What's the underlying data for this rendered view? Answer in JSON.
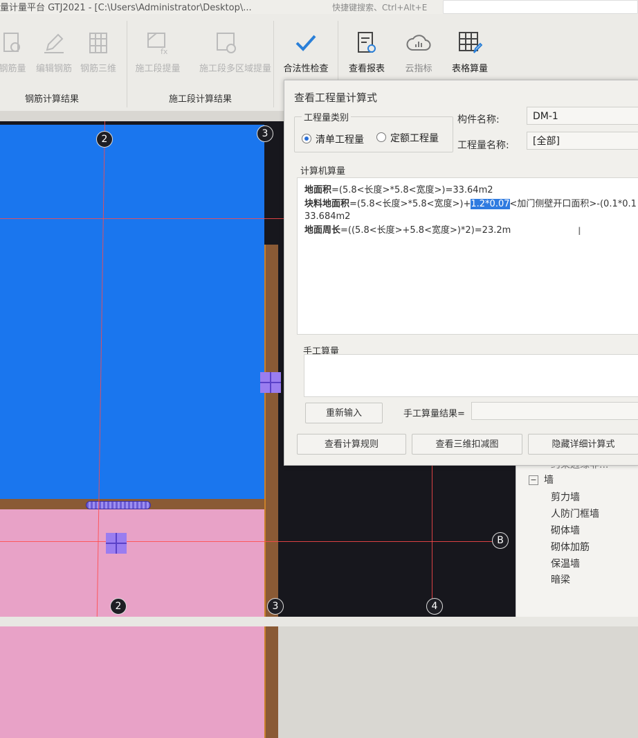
{
  "window": {
    "title": "量计量平台 GTJ2021 - [C:\\Users\\Administrator\\Desktop\\...",
    "shortcut_search": "快捷键搜索、Ctrl+Alt+E"
  },
  "ribbon": {
    "steel_buttons": [
      "钢筋量",
      "编辑钢筋",
      "钢筋三维"
    ],
    "steel_group": "钢筋计算结果",
    "construction_buttons": [
      "施工段提量",
      "施工段多区域提量"
    ],
    "construction_group": "施工段计算结果",
    "check_button": "合法性检查",
    "report_button": "查看报表",
    "cloud_button": "云指标",
    "table_button": "表格算量"
  },
  "dialog": {
    "title": "查看工程量计算式",
    "category_legend": "工程量类别",
    "radio_bill": "清单工程量",
    "radio_quota": "定额工程量",
    "component_label": "构件名称:",
    "component_value": "DM-1",
    "quantity_label": "工程量名称:",
    "quantity_value": "[全部]",
    "computer_legend": "计算机算量",
    "line1_label": "地面积",
    "line1_text": "=(5.8<长度>*5.8<宽度>)=33.64m2",
    "line2_label": "块料地面积",
    "line2_pre": "=(5.8<长度>*5.8<宽度>)+",
    "line2_highlight": "1.2*0.07",
    "line2_post": "<加门侧壁开口面积>-(0.1*0.1",
    "line3_text": "33.684m2",
    "line4_label": "地面周长",
    "line4_text": "=((5.8<长度>+5.8<宽度>)*2)=23.2m",
    "manual_legend": "手工算量",
    "reinput_button": "重新输入",
    "manual_result_label": "手工算量结果=",
    "rules_button": "查看计算规则",
    "view3d_button": "查看三维扣减图",
    "hide_button": "隐藏详细计算式"
  },
  "canvas": {
    "axis_top": [
      "2",
      "3"
    ],
    "axis_bottom": [
      "2",
      "3",
      "4"
    ],
    "axis_right": "B"
  },
  "tree": {
    "partial_item": "约束边缘非...",
    "category": "墙",
    "items": [
      "剪力墙",
      "人防门框墙",
      "砌体墙",
      "砌体加筋",
      "保温墙",
      "暗梁"
    ]
  }
}
